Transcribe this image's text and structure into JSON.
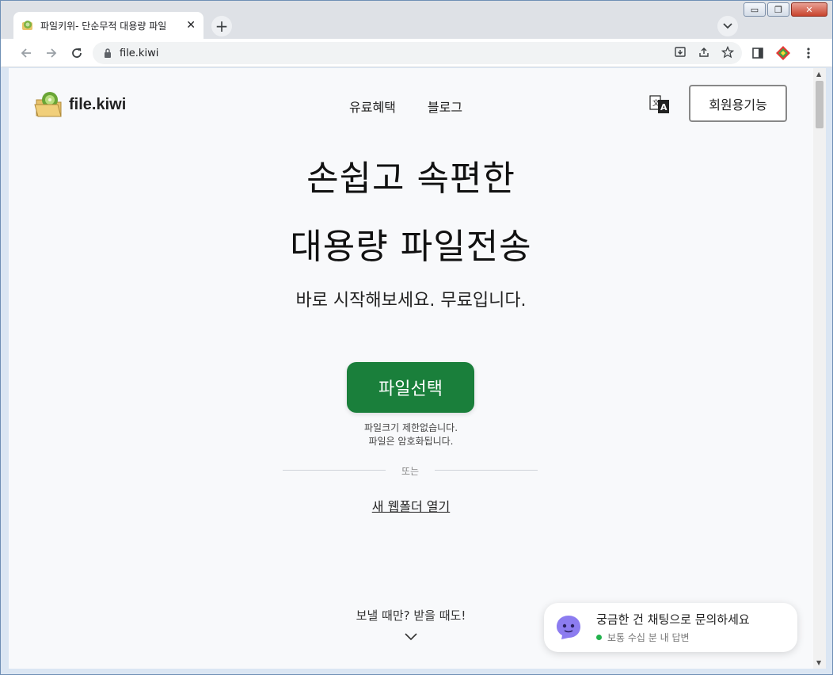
{
  "browser": {
    "tab_title": "파일키위- 단순무적 대용량 파일",
    "tab_close": "✕",
    "new_tab": "+",
    "url": "file.kiwi"
  },
  "window": {
    "minimize": "▭",
    "restore": "❐",
    "close": "✕"
  },
  "site": {
    "logo_text": "file.kiwi",
    "nav": [
      "유료혜택",
      "블로그"
    ],
    "member_button": "회원용기능"
  },
  "hero": {
    "title_line1": "손쉽고 속편한",
    "title_line2": "대용량 파일전송",
    "subtitle": "바로 시작해보세요. 무료입니다.",
    "select_button": "파일선택",
    "note_line1": "파일크기 제한없습니다.",
    "note_line2": "파일은 암호화됩니다.",
    "divider_text": "또는",
    "webfolder_link": "새 웹폴더 열기",
    "teaser": "보낼 때만? 받을 때도!"
  },
  "chat": {
    "title": "궁금한 건 채팅으로 문의하세요",
    "status": "보통 수십 분 내 답변"
  },
  "colors": {
    "accent": "#1a7f3b",
    "chat_avatar": "#8c7cf0",
    "online": "#22b24c"
  }
}
